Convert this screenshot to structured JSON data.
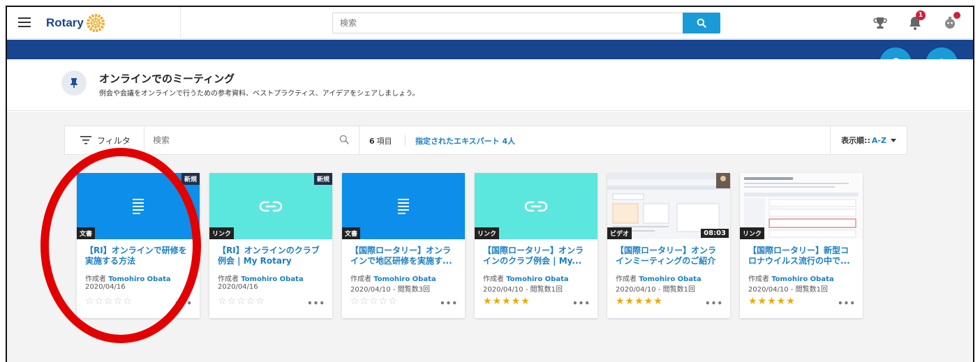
{
  "topbar": {
    "logo_text": "Rotary",
    "search_placeholder": "検索",
    "notification_count": "1"
  },
  "group": {
    "title": "オンラインでのミーティング",
    "description": "例会や会議をオンラインで行うための参考資料、ベストプラクティス、アイデアをシェアしましょう。"
  },
  "filterbar": {
    "filter_label": "フィルタ",
    "search_placeholder": "検索",
    "count_number": "6",
    "count_unit": "項目",
    "experts_link": "指定されたエキスパート 4人",
    "sort_label": "表示順::",
    "sort_value": "A-Z"
  },
  "cards": [
    {
      "type": "doc",
      "tag": "文書",
      "is_new": true,
      "new_label": "新規",
      "title": "【RI】オンラインで研修を実施する方法",
      "author_prefix": "作成者",
      "author": "Tomohiro Obata",
      "date": "2020/04/16",
      "rating": 0
    },
    {
      "type": "link",
      "tag": "リンク",
      "is_new": true,
      "new_label": "新規",
      "title": "【RI】オンラインのクラブ例会 | My Rotary",
      "author_prefix": "作成者",
      "author": "Tomohiro Obata",
      "date": "2020/04/16",
      "rating": 0
    },
    {
      "type": "doc",
      "tag": "文書",
      "is_new": false,
      "title": "【国際ロータリー】オンラインで地区研修を実施す...",
      "author_prefix": "作成者",
      "author": "Tomohiro Obata",
      "date": "2020/04/10 - 閲覧数3回",
      "rating": 0
    },
    {
      "type": "link",
      "tag": "リンク",
      "is_new": false,
      "title": "【国際ロータリー】オンラインのクラブ例会 | My...",
      "author_prefix": "作成者",
      "author": "Tomohiro Obata",
      "date": "2020/04/10 - 閲覧数1回",
      "rating": 5
    },
    {
      "type": "video",
      "tag": "ビデオ",
      "is_new": false,
      "duration": "08:03",
      "title": "【国際ロータリー】オンラインミーティングのご紹介",
      "author_prefix": "作成者",
      "author": "Tomohiro Obata",
      "date": "2020/04/10 - 閲覧数1回",
      "rating": 5
    },
    {
      "type": "link-shot",
      "tag": "リンク",
      "is_new": false,
      "title": "【国際ロータリー】新型コロナウイルス流行の中で...",
      "author_prefix": "作成者",
      "author": "Tomohiro Obata",
      "date": "2020/04/10 - 閲覧数1回",
      "rating": 5
    }
  ],
  "colors": {
    "brand_navy": "#17458f",
    "accent_blue": "#1a9bd7",
    "link_blue": "#1a7fc4",
    "doc_blue": "#0c8eea",
    "link_teal": "#5ce7de",
    "star_gold": "#f0a800",
    "annotation_red": "#e20000"
  }
}
